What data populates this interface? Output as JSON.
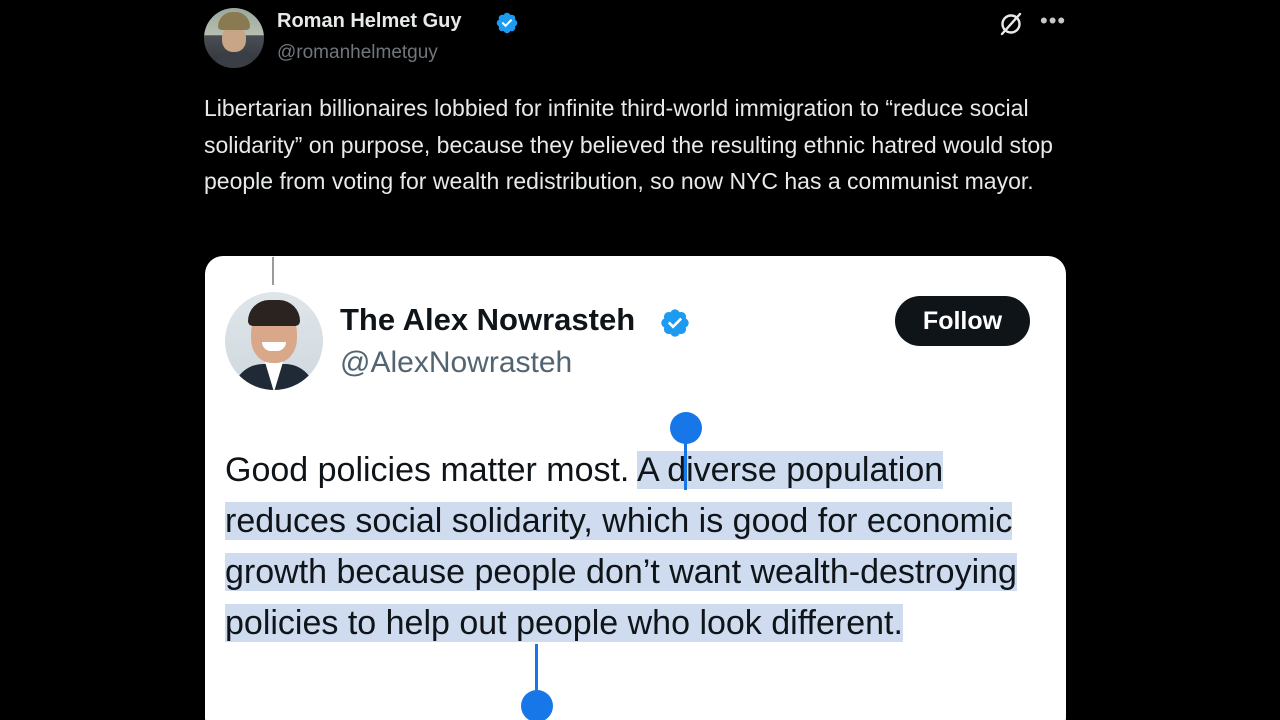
{
  "post": {
    "display_name": "Roman Helmet Guy",
    "handle": "@romanhelmetguy",
    "verified": true,
    "text": "Libertarian billionaires lobbied for infinite third-world immigration to “reduce social solidarity” on purpose, because they believed the resulting ethnic hatred would stop people from voting for wealth redistribution, so now NYC has a communist mayor.",
    "more_icon": "•••",
    "grok_icon": "grok-icon"
  },
  "quoted": {
    "display_name": "The Alex Nowrasteh",
    "handle": "@AlexNowrasteh",
    "verified": true,
    "follow_label": "Follow",
    "text_plain": "Good policies matter most. ",
    "text_selected": "A diverse population reduces social solidarity, which is good for economic growth because people don’t want wealth-destroying policies to help out people who look different."
  },
  "colors": {
    "background": "#000000",
    "verified_blue": "#1d9bf0",
    "selection_highlight": "#cfdcef",
    "selection_handle": "#1877e8"
  }
}
